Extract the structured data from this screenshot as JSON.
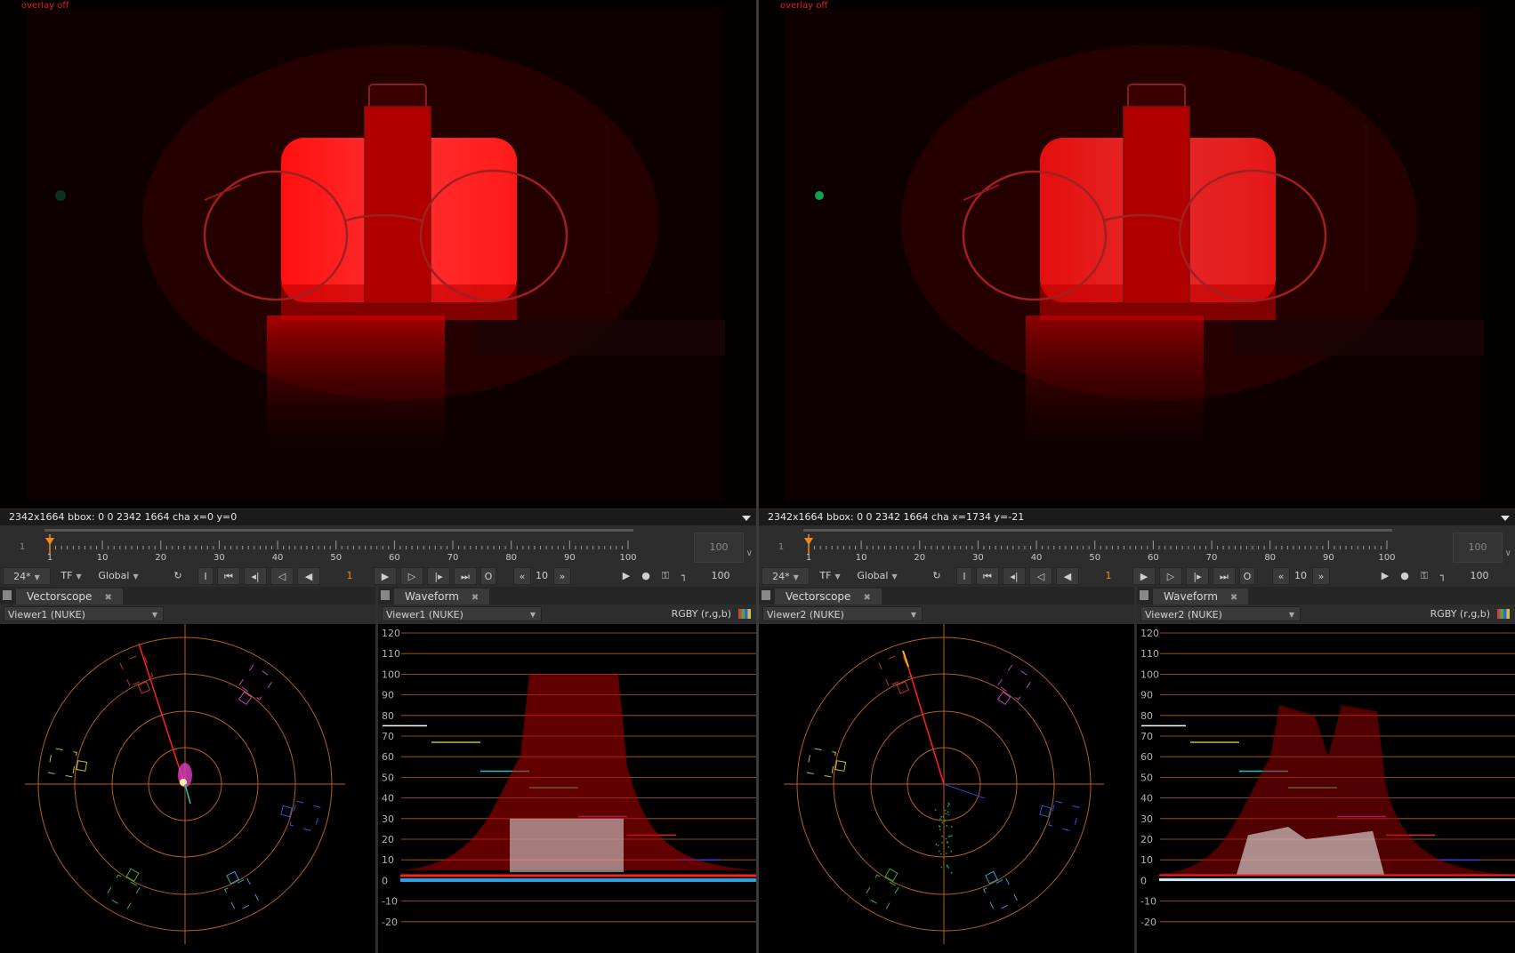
{
  "viewers": [
    {
      "id": "left",
      "overlay_label": "overlay off",
      "info": "2342x1664  bbox: 0 0 2342 1664 cha  x=0 y=0",
      "timeline": {
        "first": "1",
        "last": "100",
        "ticks": [
          "1",
          "10",
          "20",
          "30",
          "40",
          "50",
          "60",
          "70",
          "80",
          "90",
          "100"
        ],
        "current_frame": 1
      },
      "controls": {
        "fps": "24*",
        "tf": "TF",
        "global": "Global",
        "frame": "1",
        "step": "10",
        "end": "100"
      },
      "vectorscope": {
        "tab": "Vectorscope",
        "source": "Viewer1 (NUKE)"
      },
      "waveform": {
        "tab": "Waveform",
        "source": "Viewer1 (NUKE)",
        "mode": "RGBY (r,g,b)"
      }
    },
    {
      "id": "right",
      "overlay_label": "overlay off",
      "info": "2342x1664  bbox: 0 0 2342 1664 cha  x=1734 y=-21",
      "timeline": {
        "first": "1",
        "last": "100",
        "ticks": [
          "1",
          "10",
          "20",
          "30",
          "40",
          "50",
          "60",
          "70",
          "80",
          "90",
          "100"
        ],
        "current_frame": 1
      },
      "controls": {
        "fps": "24*",
        "tf": "TF",
        "global": "Global",
        "frame": "1",
        "step": "10",
        "end": "100"
      },
      "vectorscope": {
        "tab": "Vectorscope",
        "source": "Viewer2 (NUKE)"
      },
      "waveform": {
        "tab": "Waveform",
        "source": "Viewer2 (NUKE)",
        "mode": "RGBY (r,g,b)"
      }
    }
  ],
  "waveform_axis": [
    "120",
    "110",
    "100",
    "90",
    "80",
    "70",
    "60",
    "50",
    "40",
    "30",
    "20",
    "10",
    "0",
    "-10",
    "-20"
  ],
  "colors": {
    "accent": "#f08a1a",
    "overlay_text": "#e02020",
    "grid": "#b5601a",
    "trace_red": "#ff2020"
  },
  "icons": [
    "dropdown-icon",
    "sync-icon",
    "in-point-icon",
    "first-frame-icon",
    "prev-keyframe-icon",
    "step-back-icon",
    "play-backward-icon",
    "play-forward-icon",
    "step-forward-icon",
    "next-keyframe-icon",
    "last-frame-icon",
    "out-point-icon",
    "skip-back-icon",
    "skip-forward-icon",
    "flipbook-icon",
    "record-icon",
    "lock-icon",
    "range-icon",
    "close-icon",
    "panel-menu-icon"
  ]
}
